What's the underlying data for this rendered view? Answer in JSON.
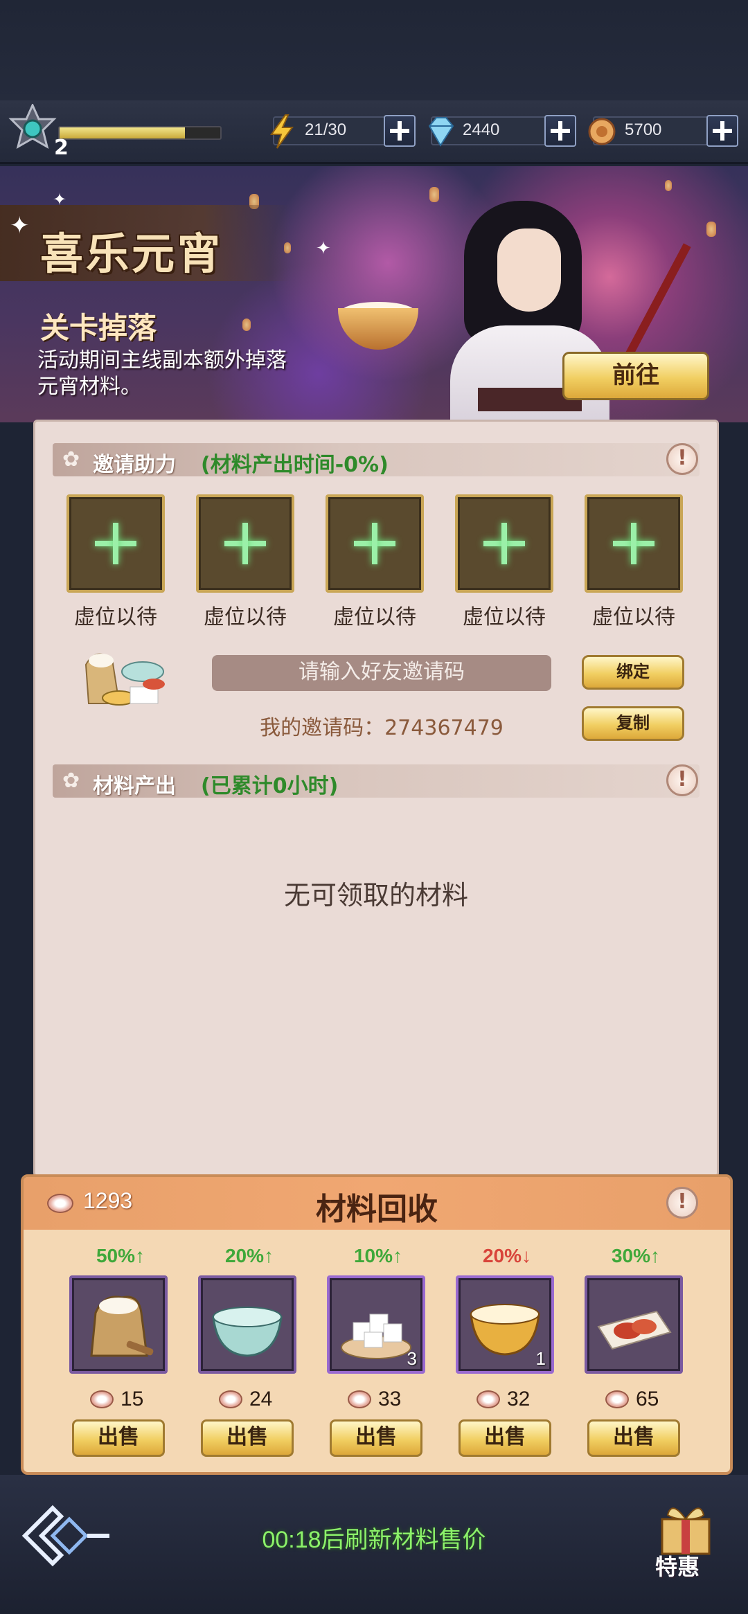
{
  "player": {
    "level": "2",
    "xp_fraction": 0.78
  },
  "resources": {
    "energy": {
      "value": "21/30",
      "icon": "lightning-icon"
    },
    "diamond": {
      "value": "2440",
      "icon": "diamond-icon"
    },
    "coin": {
      "value": "5700",
      "icon": "coin-icon"
    }
  },
  "banner": {
    "title": "喜乐元宵",
    "subtitle": "关卡掉落",
    "description": "活动期间主线副本额外掉落元宵材料。",
    "goto_label": "前往"
  },
  "invite": {
    "label": "邀请助力",
    "note": "(材料产出时间-0%)",
    "slots": [
      "虚位以待",
      "虚位以待",
      "虚位以待",
      "虚位以待",
      "虚位以待"
    ],
    "input_placeholder": "请输入好友邀请码",
    "bind_label": "绑定",
    "copy_label": "复制",
    "my_code": "我的邀请码：274367479"
  },
  "output": {
    "label": "材料产出",
    "note": "(已累计0小时)",
    "empty_message": "无可领取的材料"
  },
  "recycle": {
    "title": "材料回收",
    "currency_count": "1293",
    "sell_label": "出售",
    "items": [
      {
        "name": "flour-sack",
        "change": "50%↑",
        "trend": "up",
        "price": "15",
        "qty": ""
      },
      {
        "name": "water-bowl",
        "change": "20%↑",
        "trend": "up",
        "price": "24",
        "qty": ""
      },
      {
        "name": "sugar-cubes",
        "change": "10%↑",
        "trend": "up",
        "price": "33",
        "qty": "3"
      },
      {
        "name": "golden-bowl",
        "change": "20%↓",
        "trend": "down",
        "price": "32",
        "qty": "1"
      },
      {
        "name": "red-bean-paste",
        "change": "30%↑",
        "trend": "up",
        "price": "65",
        "qty": ""
      }
    ],
    "colors": {
      "up": "#3fa83a",
      "down": "#d8443a"
    }
  },
  "footer": {
    "refresh_text": "00:18后刷新材料售价",
    "gift_label": "特惠"
  }
}
